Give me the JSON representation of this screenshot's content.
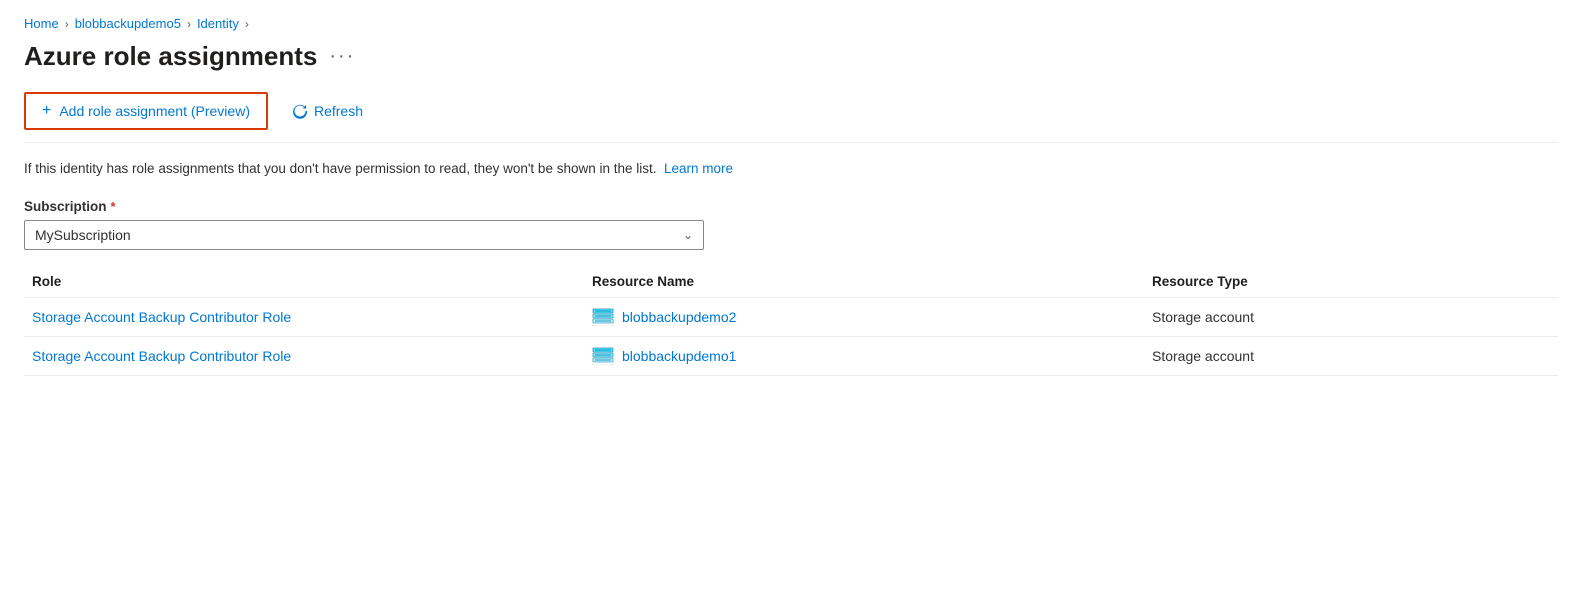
{
  "breadcrumb": {
    "items": [
      {
        "label": "Home",
        "href": "#"
      },
      {
        "label": "blobbackupdemo5",
        "href": "#"
      },
      {
        "label": "Identity",
        "href": "#"
      }
    ],
    "separator": ">"
  },
  "page": {
    "title": "Azure role assignments",
    "more_label": "···"
  },
  "toolbar": {
    "add_button_label": "Add role assignment (Preview)",
    "refresh_label": "Refresh"
  },
  "info": {
    "text": "If this identity has role assignments that you don't have permission to read, they won't be shown in the list.",
    "learn_more_label": "Learn more",
    "learn_more_href": "#"
  },
  "subscription": {
    "label": "Subscription",
    "required": true,
    "value": "MySubscription"
  },
  "table": {
    "columns": [
      "Role",
      "Resource Name",
      "Resource Type"
    ],
    "rows": [
      {
        "role": "Storage Account Backup Contributor Role",
        "resource_name": "blobbackupdemo2",
        "resource_type": "Storage account"
      },
      {
        "role": "Storage Account Backup Contributor Role",
        "resource_name": "blobbackupdemo1",
        "resource_type": "Storage account"
      }
    ]
  }
}
